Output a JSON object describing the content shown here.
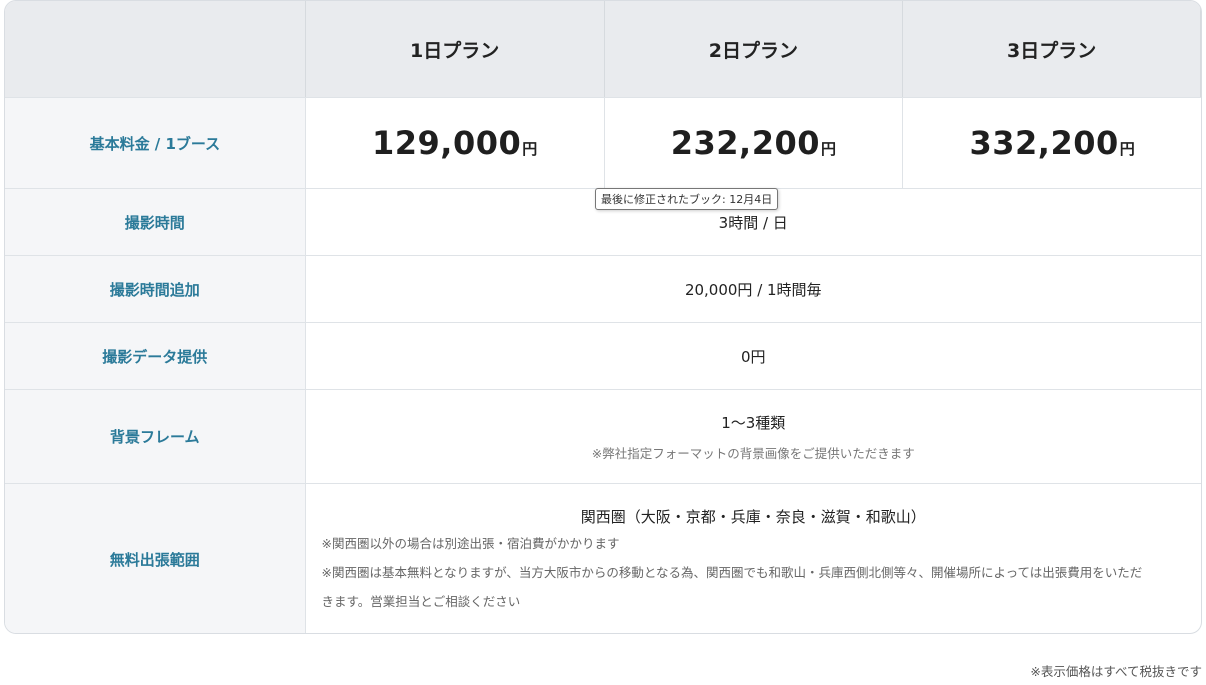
{
  "header": {
    "plans": [
      "1日プラン",
      "2日プラン",
      "3日プラン"
    ]
  },
  "rows": {
    "base_fee": {
      "label": "基本料金 / 1ブース",
      "prices": [
        "129,000",
        "232,200",
        "332,200"
      ],
      "unit": "円"
    },
    "shoot_time": {
      "label": "撮影時間",
      "value": "3時間 / 日"
    },
    "extra_time": {
      "label": "撮影時間追加",
      "value": "20,000円 / 1時間毎"
    },
    "data_provide": {
      "label": "撮影データ提供",
      "value": "0円"
    },
    "frame": {
      "label": "背景フレーム",
      "value": "1〜3種類",
      "note": "※弊社指定フォーマットの背景画像をご提供いただきます"
    },
    "travel": {
      "label": "無料出張範囲",
      "value": "関西圏（大阪・京都・兵庫・奈良・滋賀・和歌山）",
      "notes": [
        "※関西圏以外の場合は別途出張・宿泊費がかかります",
        "※関西圏は基本無料となりますが、当方大阪市からの移動となる為、関西圏でも和歌山・兵庫西側北側等々、開催場所によっては出張費用をいただ",
        "きます。営業担当とご相談ください"
      ]
    }
  },
  "tooltip": "最後に修正されたブック: 12月4日",
  "footer_note": "※表示価格はすべて税抜きです"
}
